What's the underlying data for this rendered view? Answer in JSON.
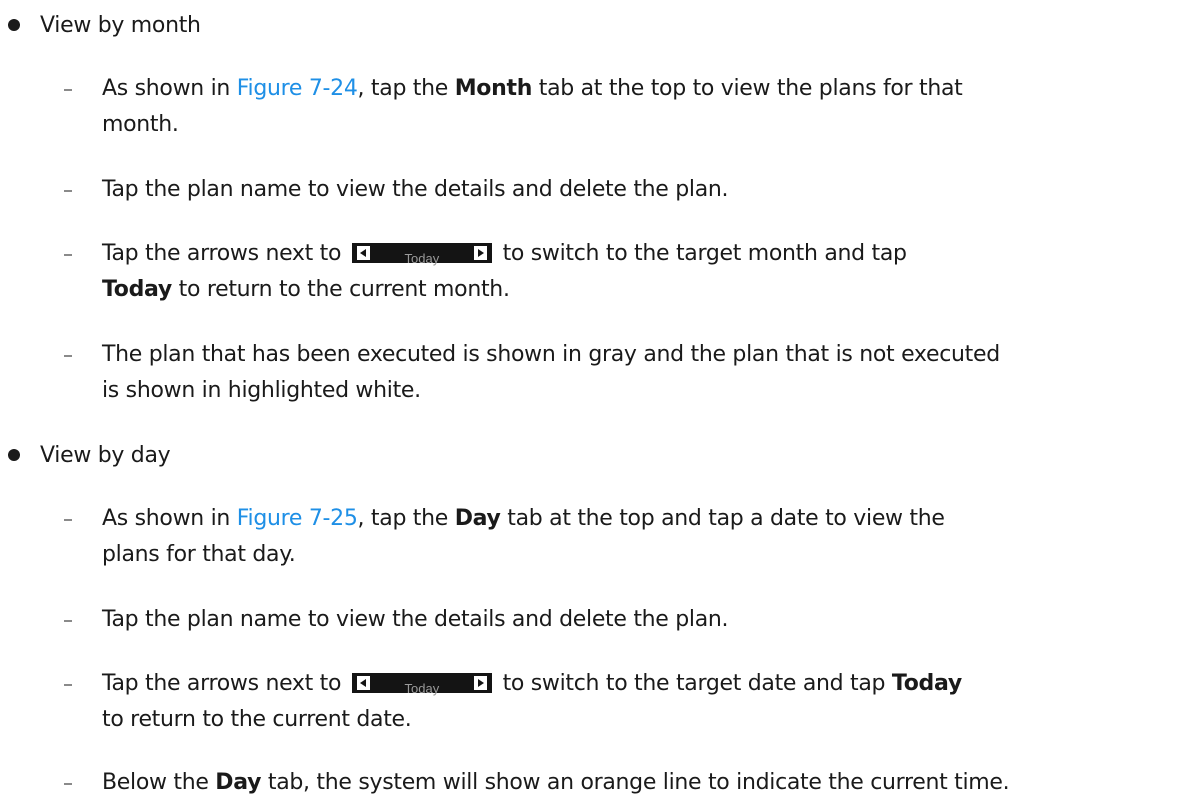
{
  "month_section": {
    "bullet": "View by month",
    "item1": {
      "pre": "As shown in ",
      "link": "Figure 7-24",
      "mid": ", tap the ",
      "bold": "Month",
      "post": " tab at the top to view the plans for that",
      "line2": "month."
    },
    "item2": {
      "text": "Tap the plan name to view the details and delete the plan."
    },
    "item3": {
      "pre": "Tap the arrows next to",
      "widget_label": "Today",
      "post": "to switch to the target month and tap",
      "line2_bold": "Today",
      "line2_post": " to return to the current month."
    },
    "item4": {
      "line1": "The plan that has been executed is shown in gray and the plan that is not executed",
      "line2": "is shown in highlighted white."
    }
  },
  "day_section": {
    "bullet": "View by day",
    "item1": {
      "pre": "As shown in ",
      "link": "Figure 7-25",
      "mid": ", tap the ",
      "bold": "Day",
      "post": " tab at the top and tap a date to view the",
      "line2": "plans for that day."
    },
    "item2": {
      "text": "Tap the plan name to view the details and delete the plan."
    },
    "item3": {
      "pre": "Tap the arrows next to",
      "widget_label": "Today",
      "post": "to switch to the target date and tap",
      "post_bold": "Today",
      "line2": "to return to the current date."
    },
    "item4": {
      "pre": "Below the ",
      "bold": "Day",
      "post": " tab, the system will show an orange line to indicate the current time."
    }
  },
  "colors": {
    "link": "#1e8fe6",
    "text": "#1a1a1a",
    "widget_bg": "#141414"
  }
}
